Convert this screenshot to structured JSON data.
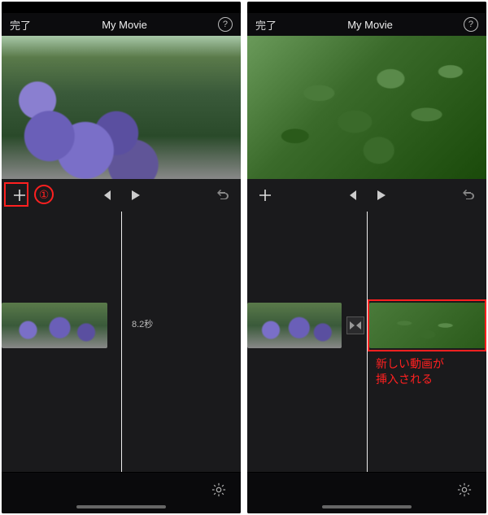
{
  "left": {
    "done_label": "完了",
    "title": "My Movie",
    "clip_duration": "8.2秒",
    "annotation_number": "①"
  },
  "right": {
    "done_label": "完了",
    "title": "My Movie",
    "annotation_line1": "新しい動画が",
    "annotation_line2": "挿入される"
  }
}
